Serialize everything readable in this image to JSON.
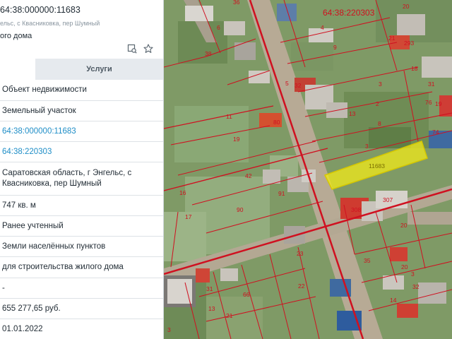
{
  "header": {
    "cadastral_number": "64:38:000000:11683",
    "address": "ельс, с Квасниковка, пер Шумный",
    "purpose": "ого дома",
    "icons": [
      "map-locate-icon",
      "star-icon"
    ]
  },
  "tabs": [
    {
      "label": ""
    },
    {
      "label": "Услуги"
    }
  ],
  "rows": [
    {
      "value": "Объект недвижимости"
    },
    {
      "value": "Земельный участок"
    },
    {
      "value": "64:38:000000:11683",
      "link": true
    },
    {
      "value": "64:38:220303",
      "link": true
    },
    {
      "value": "Саратовская область, г Энгельс, с Квасниковка, пер Шумный"
    },
    {
      "value": "747 кв. м"
    },
    {
      "value": "Ранее учтенный"
    },
    {
      "value": "Земли населённых пунктов"
    },
    {
      "value": "для строительства жилого дома"
    },
    {
      "value": "-"
    },
    {
      "value": "655 277,65 руб."
    },
    {
      "value": "01.01.2022"
    }
  ],
  "map": {
    "quarter_label": "64:38:220303",
    "highlighted_parcel": "11683",
    "parcel_labels": [
      "20",
      "4",
      "21",
      "293",
      "5",
      "9",
      "18",
      "32",
      "3",
      "31",
      "2",
      "19",
      "13",
      "8",
      "74",
      "76",
      "11",
      "80",
      "19",
      "3",
      "42",
      "91",
      "16",
      "90",
      "17",
      "308",
      "307",
      "20",
      "23",
      "35",
      "20",
      "31",
      "66",
      "3",
      "32",
      "14",
      "22",
      "21",
      "13",
      "38",
      "6",
      "36",
      "3"
    ],
    "colors": {
      "boundary": "#d01020",
      "highlight": "#f2ea1a"
    }
  }
}
